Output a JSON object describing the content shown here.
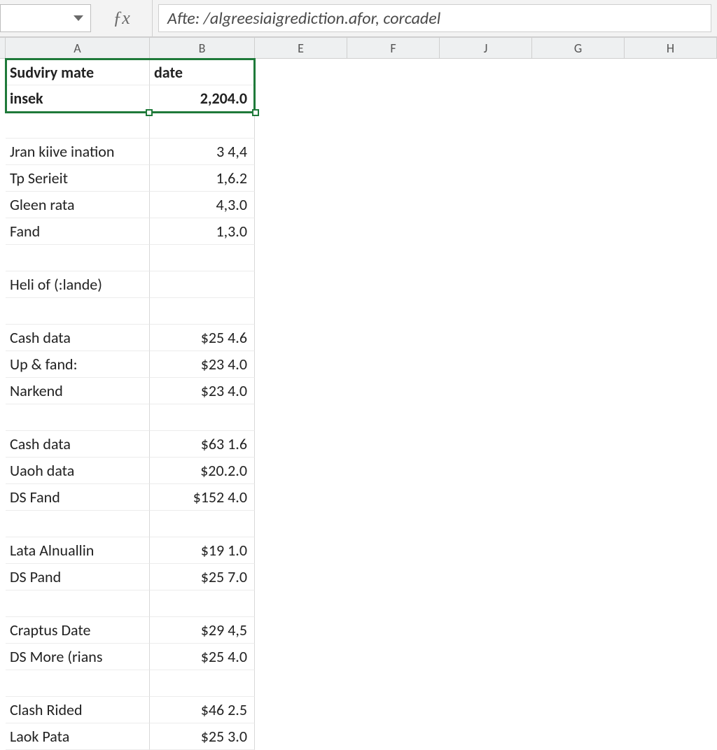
{
  "formula_bar": {
    "name_box_text": "",
    "fx_label": "ƒx",
    "formula_text": "Afte: /algreesiaigrediction.afor, corcadel"
  },
  "column_headers": [
    "A",
    "B",
    "E",
    "F",
    "J",
    "G",
    "H"
  ],
  "header_block": {
    "a1": "Sudviry mate",
    "a2": "insek",
    "b1": "date",
    "b2": "2,204.0"
  },
  "rows": [
    {
      "a": "",
      "b": ""
    },
    {
      "a": "Jran kiive ination",
      "b": "3 4,4"
    },
    {
      "a": "Tp Serieit",
      "b": "1,6.2"
    },
    {
      "a": "Gleen rata",
      "b": "4,3.0"
    },
    {
      "a": "Fand",
      "b": "1,3.0"
    },
    {
      "a": "",
      "b": ""
    },
    {
      "a": "Heli of (:lande)",
      "b": ""
    },
    {
      "a": "",
      "b": ""
    },
    {
      "a": "Cash data",
      "b": "$25 4.6"
    },
    {
      "a": "Up & fand:",
      "b": "$23 4.0"
    },
    {
      "a": "Narkend",
      "b": "$23 4.0"
    },
    {
      "a": "",
      "b": ""
    },
    {
      "a": "Cash data",
      "b": "$63 1.6"
    },
    {
      "a": "Uaoh data",
      "b": "$20.2.0"
    },
    {
      "a": "DS Fand",
      "b": "$152 4.0"
    },
    {
      "a": "",
      "b": ""
    },
    {
      "a": "Lata Alnuallin",
      "b": "$19 1.0"
    },
    {
      "a": "DS Pand",
      "b": "$25 7.0"
    },
    {
      "a": "",
      "b": ""
    },
    {
      "a": "Craptus Date",
      "b": "$29 4,5"
    },
    {
      "a": "DS More (rians",
      "b": "$25 4.0"
    },
    {
      "a": "",
      "b": ""
    },
    {
      "a": "Clash Rided",
      "b": "$46 2.5"
    },
    {
      "a": "Laok Pata",
      "b": "$25 3.0"
    }
  ],
  "colors": {
    "selection_green": "#1f7a3a"
  }
}
